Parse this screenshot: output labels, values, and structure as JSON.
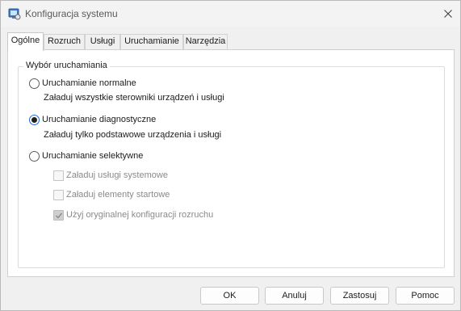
{
  "window": {
    "title": "Konfiguracja systemu",
    "icon": "msconfig-icon"
  },
  "tabs": [
    {
      "label": "Ogólne",
      "active": true
    },
    {
      "label": "Rozruch",
      "active": false
    },
    {
      "label": "Usługi",
      "active": false
    },
    {
      "label": "Uruchamianie",
      "active": false
    },
    {
      "label": "Narzędzia",
      "active": false
    }
  ],
  "startup_group": {
    "legend": "Wybór uruchamiania",
    "options": [
      {
        "label": "Uruchamianie normalne",
        "description": "Załaduj wszystkie sterowniki urządzeń i usługi",
        "selected": false
      },
      {
        "label": "Uruchamianie diagnostyczne",
        "description": "Załaduj tylko podstawowe urządzenia i usługi",
        "selected": true
      },
      {
        "label": "Uruchamianie selektywne",
        "selected": false
      }
    ],
    "selective_checks": [
      {
        "label": "Załaduj usługi systemowe",
        "checked": false,
        "enabled": false
      },
      {
        "label": "Załaduj elementy startowe",
        "checked": false,
        "enabled": false
      },
      {
        "label": "Użyj oryginalnej konfiguracji rozruchu",
        "checked": true,
        "enabled": false
      }
    ]
  },
  "buttons": {
    "ok": "OK",
    "cancel": "Anuluj",
    "apply": "Zastosuj",
    "help": "Pomoc"
  },
  "colors": {
    "accent": "#2a6ad4",
    "panel_bg": "#ffffff",
    "window_bg": "#f0f0f0",
    "disabled_text": "#8a8a8a"
  }
}
